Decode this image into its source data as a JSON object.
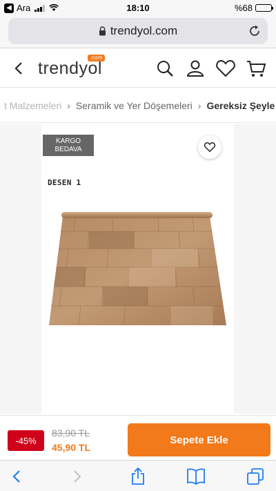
{
  "status_bar": {
    "carrier": "Ara",
    "time": "18:10",
    "battery": "%68",
    "battery_level": 0.68
  },
  "browser": {
    "url": "trendyol.com",
    "icons": [
      "lock-icon",
      "reload-icon",
      "back-icon",
      "forward-icon",
      "share-icon",
      "bookmarks-icon",
      "tabs-icon"
    ]
  },
  "header": {
    "logo": "trendyol",
    "logo_badge": ".com",
    "icons": [
      "back-icon",
      "search-icon",
      "user-icon",
      "heart-icon",
      "cart-icon"
    ]
  },
  "breadcrumb": {
    "items": [
      {
        "label": "t Malzemeleri"
      },
      {
        "label": "Seramik ve Yer Döşemeleri"
      },
      {
        "label": "Gereksiz Şeyle"
      }
    ]
  },
  "product": {
    "badge_line1": "KARGO",
    "badge_line2": "BEDAVA",
    "pattern_label": "DESEN 1"
  },
  "price_bar": {
    "discount": "-45%",
    "old_price": "83,90 TL",
    "new_price": "45,90 TL",
    "add_to_cart": "Sepete Ekle"
  },
  "colors": {
    "brand_orange": "#f27a1a",
    "discount_red": "#d0021b",
    "ios_blue": "#1a7cf4"
  }
}
